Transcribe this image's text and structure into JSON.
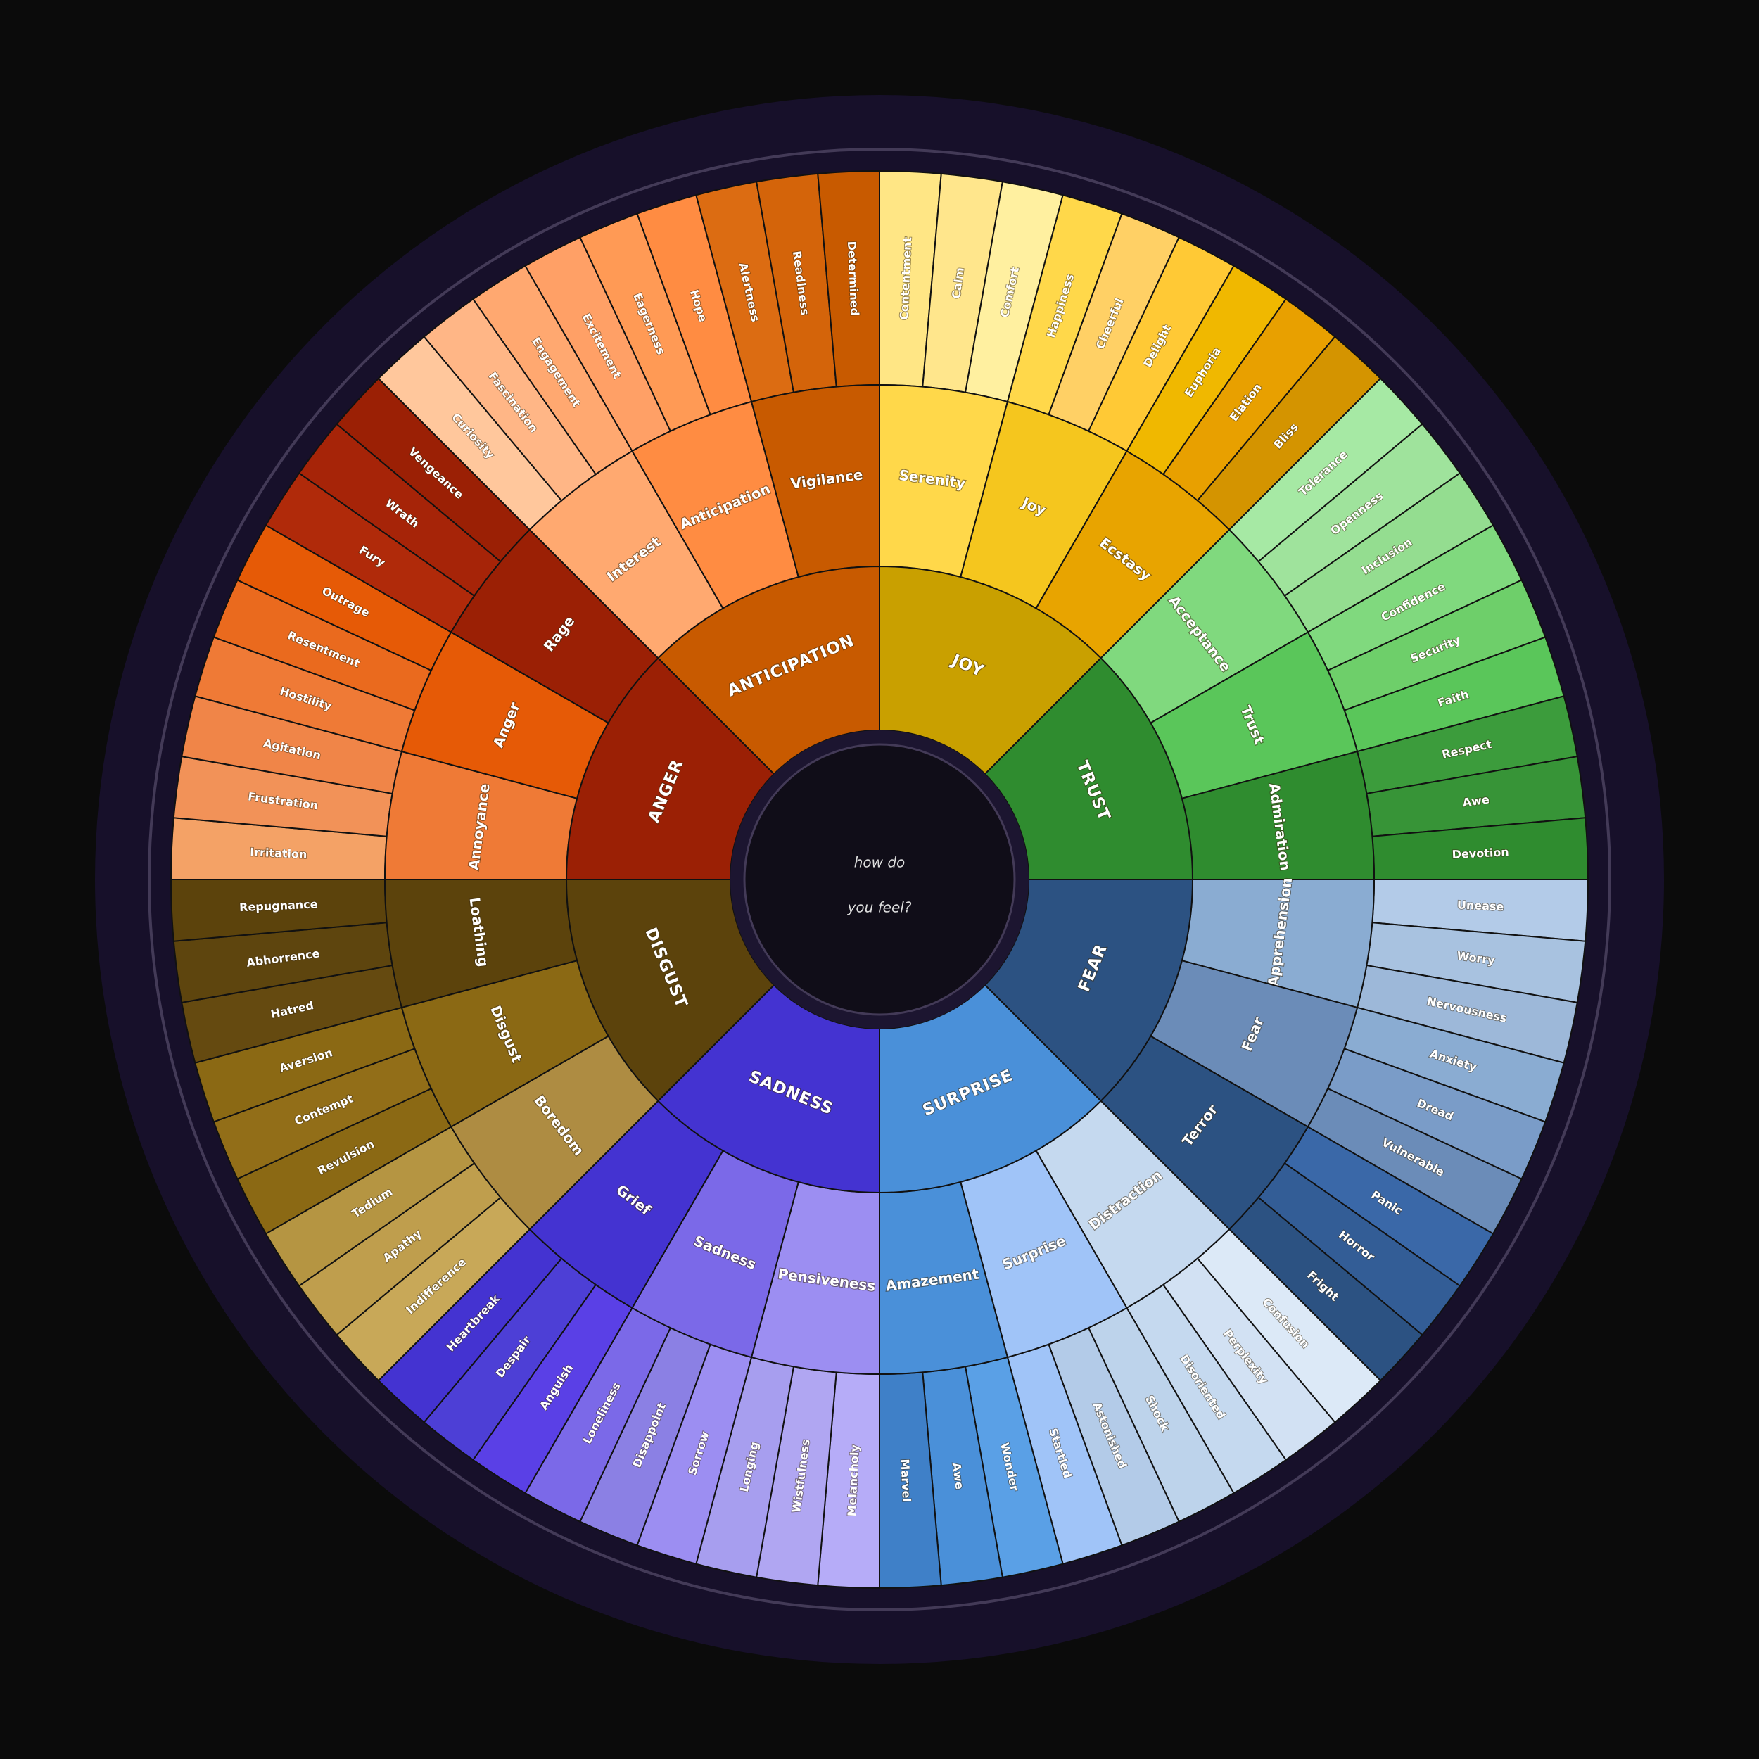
{
  "center": {
    "line1": "how do",
    "line2": "you feel?"
  },
  "colors": {
    "page_background": "#0b0b0b",
    "frame": "#17102a",
    "frame_ring": "#433a57",
    "center_fill": "#100d18"
  },
  "wheel": [
    {
      "name": "JOY",
      "color": "#c9a000",
      "children": [
        {
          "name": "Serenity",
          "color": "#ffd84a",
          "children": [
            {
              "name": "Contentment",
              "color": "#ffe685"
            },
            {
              "name": "Calm",
              "color": "#ffe68c"
            },
            {
              "name": "Comfort",
              "color": "#fff0a0"
            }
          ]
        },
        {
          "name": "Joy",
          "color": "#f5c61e",
          "children": [
            {
              "name": "Happiness",
              "color": "#ffd84a"
            },
            {
              "name": "Cheerful",
              "color": "#ffd065"
            },
            {
              "name": "Delight",
              "color": "#ffc935"
            }
          ]
        },
        {
          "name": "Ecstasy",
          "color": "#e8a400",
          "children": [
            {
              "name": "Euphoria",
              "color": "#f0b800"
            },
            {
              "name": "Elation",
              "color": "#e8a000"
            },
            {
              "name": "Bliss",
              "color": "#d49400"
            }
          ]
        }
      ]
    },
    {
      "name": "TRUST",
      "color": "#2f8c2f",
      "children": [
        {
          "name": "Acceptance",
          "color": "#80d97e",
          "children": [
            {
              "name": "Tolerance",
              "color": "#a6e9a4"
            },
            {
              "name": "Openness",
              "color": "#9fe39c"
            },
            {
              "name": "Inclusion",
              "color": "#94dd90"
            }
          ]
        },
        {
          "name": "Trust",
          "color": "#5ac65a",
          "children": [
            {
              "name": "Confidence",
              "color": "#80d97e"
            },
            {
              "name": "Security",
              "color": "#6ecf6a"
            },
            {
              "name": "Faith",
              "color": "#5ac65a"
            }
          ]
        },
        {
          "name": "Admiration",
          "color": "#2f8c2f",
          "children": [
            {
              "name": "Respect",
              "color": "#3c9c3c"
            },
            {
              "name": "Awe",
              "color": "#379437"
            },
            {
              "name": "Devotion",
              "color": "#2f8c2f"
            }
          ]
        }
      ]
    },
    {
      "name": "FEAR",
      "color": "#2c5282",
      "children": [
        {
          "name": "Apprehension",
          "color": "#8aacd2",
          "children": [
            {
              "name": "Unease",
              "color": "#b3cbe8"
            },
            {
              "name": "Worry",
              "color": "#a8c2e0"
            },
            {
              "name": "Nervousness",
              "color": "#9db8d9"
            }
          ]
        },
        {
          "name": "Fear",
          "color": "#6b8cb8",
          "children": [
            {
              "name": "Anxiety",
              "color": "#8aacd2"
            },
            {
              "name": "Dread",
              "color": "#7a9cc8"
            },
            {
              "name": "Vulnerable",
              "color": "#6b8cb8"
            }
          ]
        },
        {
          "name": "Terror",
          "color": "#2c5282",
          "children": [
            {
              "name": "Panic",
              "color": "#3a68a8"
            },
            {
              "name": "Horror",
              "color": "#335d96"
            },
            {
              "name": "Fright",
              "color": "#2c5282"
            }
          ]
        }
      ]
    },
    {
      "name": "SURPRISE",
      "color": "#4a90d9",
      "children": [
        {
          "name": "Distraction",
          "color": "#c5d9ef",
          "children": [
            {
              "name": "Confusion",
              "color": "#dce9f7"
            },
            {
              "name": "Perplexity",
              "color": "#d2e1f3"
            },
            {
              "name": "Disoriented",
              "color": "#c5d9ef"
            }
          ]
        },
        {
          "name": "Surprise",
          "color": "#a0c4f8",
          "children": [
            {
              "name": "Shock",
              "color": "#bdd3eb"
            },
            {
              "name": "Astonished",
              "color": "#b3cbe8"
            },
            {
              "name": "Startled",
              "color": "#a0c4f8"
            }
          ]
        },
        {
          "name": "Amazement",
          "color": "#4a90d9",
          "children": [
            {
              "name": "Wonder",
              "color": "#5aa0e6"
            },
            {
              "name": "Awe",
              "color": "#4a90d9"
            },
            {
              "name": "Marvel",
              "color": "#3f80c8"
            }
          ]
        }
      ]
    },
    {
      "name": "SADNESS",
      "color": "#4433d1",
      "children": [
        {
          "name": "Pensiveness",
          "color": "#9c8ef2",
          "children": [
            {
              "name": "Melancholy",
              "color": "#b6acf8"
            },
            {
              "name": "Wistfulness",
              "color": "#b0a6f2"
            },
            {
              "name": "Longing",
              "color": "#a79eef"
            }
          ]
        },
        {
          "name": "Sadness",
          "color": "#7b69e8",
          "children": [
            {
              "name": "Sorrow",
              "color": "#9c8ef2"
            },
            {
              "name": "Disappoint",
              "color": "#8b80e4"
            },
            {
              "name": "Loneliness",
              "color": "#7b69e8"
            }
          ]
        },
        {
          "name": "Grief",
          "color": "#4433d1",
          "children": [
            {
              "name": "Anguish",
              "color": "#5a40e6"
            },
            {
              "name": "Despair",
              "color": "#4d3fd6"
            },
            {
              "name": "Heartbreak",
              "color": "#4433d1"
            }
          ]
        }
      ]
    },
    {
      "name": "DISGUST",
      "color": "#5c430c",
      "children": [
        {
          "name": "Boredom",
          "color": "#ae8c42",
          "children": [
            {
              "name": "Indifference",
              "color": "#c8a858"
            },
            {
              "name": "Apathy",
              "color": "#bf9e4d"
            },
            {
              "name": "Tedium",
              "color": "#b59542"
            }
          ]
        },
        {
          "name": "Disgust",
          "color": "#8b6914",
          "children": [
            {
              "name": "Revulsion",
              "color": "#8b6914"
            },
            {
              "name": "Contempt",
              "color": "#926e18"
            },
            {
              "name": "Aversion",
              "color": "#8b6914"
            }
          ]
        },
        {
          "name": "Loathing",
          "color": "#5c430c",
          "children": [
            {
              "name": "Hatred",
              "color": "#654a10"
            },
            {
              "name": "Abhorrence",
              "color": "#5e450e"
            },
            {
              "name": "Repugnance",
              "color": "#5c430c"
            }
          ]
        }
      ]
    },
    {
      "name": "ANGER",
      "color": "#9b2005",
      "children": [
        {
          "name": "Annoyance",
          "color": "#ef7a36",
          "children": [
            {
              "name": "Irritation",
              "color": "#f4a266"
            },
            {
              "name": "Frustration",
              "color": "#f29258"
            },
            {
              "name": "Agitation",
              "color": "#f08548"
            }
          ]
        },
        {
          "name": "Anger",
          "color": "#e65a06",
          "children": [
            {
              "name": "Hostility",
              "color": "#ef7a36"
            },
            {
              "name": "Resentment",
              "color": "#ea6a1e"
            },
            {
              "name": "Outrage",
              "color": "#e65a06"
            }
          ]
        },
        {
          "name": "Rage",
          "color": "#9b2005",
          "children": [
            {
              "name": "Fury",
              "color": "#b02a0a"
            },
            {
              "name": "Wrath",
              "color": "#a62408"
            },
            {
              "name": "Vengeance",
              "color": "#9b2005"
            }
          ]
        }
      ]
    },
    {
      "name": "ANTICIPATION",
      "color": "#c85a00",
      "children": [
        {
          "name": "Interest",
          "color": "#ffa970",
          "children": [
            {
              "name": "Curiosity",
              "color": "#ffc79c"
            },
            {
              "name": "Fascination",
              "color": "#ffb686"
            },
            {
              "name": "Engagement",
              "color": "#ffa870"
            }
          ]
        },
        {
          "name": "Anticipation",
          "color": "#ff8c42",
          "children": [
            {
              "name": "Excitement",
              "color": "#ffa066"
            },
            {
              "name": "Eagerness",
              "color": "#ff9a55"
            },
            {
              "name": "Hope",
              "color": "#ff8c42"
            }
          ]
        },
        {
          "name": "Vigilance",
          "color": "#c85a00",
          "children": [
            {
              "name": "Alertness",
              "color": "#dc6c12"
            },
            {
              "name": "Readiness",
              "color": "#d4640a"
            },
            {
              "name": "Determined",
              "color": "#c85a00"
            }
          ]
        }
      ]
    }
  ]
}
